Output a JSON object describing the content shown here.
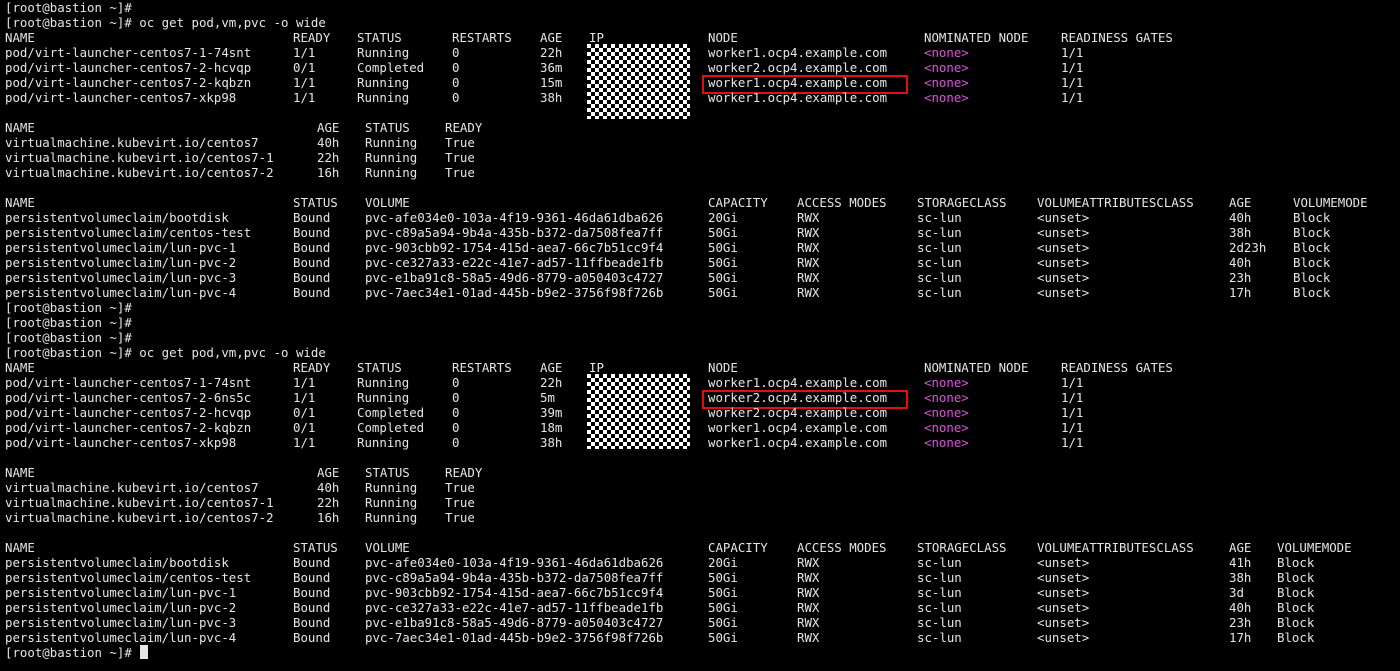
{
  "terminal": {
    "prompt": "[root@bastion ~]#",
    "command": " oc get pod,vm,pvc -o wide"
  },
  "blocks": [
    {
      "pod_header": [
        "NAME",
        "READY",
        "STATUS",
        "RESTARTS",
        "AGE",
        "IP",
        "NODE",
        "NOMINATED NODE",
        "READINESS GATES"
      ],
      "pods": [
        [
          "pod/virt-launcher-centos7-1-74snt",
          "1/1",
          "Running",
          "0",
          "22h",
          "",
          "worker1.ocp4.example.com",
          "<none>",
          "1/1"
        ],
        [
          "pod/virt-launcher-centos7-2-hcvqp",
          "0/1",
          "Completed",
          "0",
          "36m",
          "",
          "worker2.ocp4.example.com",
          "<none>",
          "1/1"
        ],
        [
          "pod/virt-launcher-centos7-2-kqbzn",
          "1/1",
          "Running",
          "0",
          "15m",
          "",
          "worker1.ocp4.example.com",
          "<none>",
          "1/1"
        ],
        [
          "pod/virt-launcher-centos7-xkp98",
          "1/1",
          "Running",
          "0",
          "38h",
          "",
          "worker1.ocp4.example.com",
          "<none>",
          "1/1"
        ]
      ],
      "vm_header": [
        "NAME",
        "AGE",
        "STATUS",
        "READY"
      ],
      "vms": [
        [
          "virtualmachine.kubevirt.io/centos7",
          "40h",
          "Running",
          "True"
        ],
        [
          "virtualmachine.kubevirt.io/centos7-1",
          "22h",
          "Running",
          "True"
        ],
        [
          "virtualmachine.kubevirt.io/centos7-2",
          "16h",
          "Running",
          "True"
        ]
      ],
      "pvc_header": [
        "NAME",
        "STATUS",
        "VOLUME",
        "CAPACITY",
        "ACCESS MODES",
        "STORAGECLASS",
        "VOLUMEATTRIBUTESCLASS",
        "AGE",
        "VOLUMEMODE"
      ],
      "pvcs": [
        [
          "persistentvolumeclaim/bootdisk",
          "Bound",
          "pvc-afe034e0-103a-4f19-9361-46da61dba626",
          "20Gi",
          "RWX",
          "sc-lun",
          "<unset>",
          "40h",
          "Block"
        ],
        [
          "persistentvolumeclaim/centos-test",
          "Bound",
          "pvc-c89a5a94-9b4a-435b-b372-da7508fea7ff",
          "50Gi",
          "RWX",
          "sc-lun",
          "<unset>",
          "38h",
          "Block"
        ],
        [
          "persistentvolumeclaim/lun-pvc-1",
          "Bound",
          "pvc-903cbb92-1754-415d-aea7-66c7b51cc9f4",
          "50Gi",
          "RWX",
          "sc-lun",
          "<unset>",
          "2d23h",
          "Block"
        ],
        [
          "persistentvolumeclaim/lun-pvc-2",
          "Bound",
          "pvc-ce327a33-e22c-41e7-ad57-11ffbeade1fb",
          "50Gi",
          "RWX",
          "sc-lun",
          "<unset>",
          "40h",
          "Block"
        ],
        [
          "persistentvolumeclaim/lun-pvc-3",
          "Bound",
          "pvc-e1ba91c8-58a5-49d6-8779-a050403c4727",
          "50Gi",
          "RWX",
          "sc-lun",
          "<unset>",
          "23h",
          "Block"
        ],
        [
          "persistentvolumeclaim/lun-pvc-4",
          "Bound",
          "pvc-7aec34e1-01ad-445b-b9e2-3756f98f726b",
          "50Gi",
          "RWX",
          "sc-lun",
          "<unset>",
          "17h",
          "Block"
        ]
      ]
    },
    {
      "pod_header": [
        "NAME",
        "READY",
        "STATUS",
        "RESTARTS",
        "AGE",
        "IP",
        "NODE",
        "NOMINATED NODE",
        "READINESS GATES"
      ],
      "pods": [
        [
          "pod/virt-launcher-centos7-1-74snt",
          "1/1",
          "Running",
          "0",
          "22h",
          "",
          "worker1.ocp4.example.com",
          "<none>",
          "1/1"
        ],
        [
          "pod/virt-launcher-centos7-2-6ns5c",
          "1/1",
          "Running",
          "0",
          "5m",
          "",
          "worker2.ocp4.example.com",
          "<none>",
          "1/1"
        ],
        [
          "pod/virt-launcher-centos7-2-hcvqp",
          "0/1",
          "Completed",
          "0",
          "39m",
          "",
          "worker2.ocp4.example.com",
          "<none>",
          "1/1"
        ],
        [
          "pod/virt-launcher-centos7-2-kqbzn",
          "0/1",
          "Completed",
          "0",
          "18m",
          "",
          "worker1.ocp4.example.com",
          "<none>",
          "1/1"
        ],
        [
          "pod/virt-launcher-centos7-xkp98",
          "1/1",
          "Running",
          "0",
          "38h",
          "",
          "worker1.ocp4.example.com",
          "<none>",
          "1/1"
        ]
      ],
      "vm_header": [
        "NAME",
        "AGE",
        "STATUS",
        "READY"
      ],
      "vms": [
        [
          "virtualmachine.kubevirt.io/centos7",
          "40h",
          "Running",
          "True"
        ],
        [
          "virtualmachine.kubevirt.io/centos7-1",
          "22h",
          "Running",
          "True"
        ],
        [
          "virtualmachine.kubevirt.io/centos7-2",
          "16h",
          "Running",
          "True"
        ]
      ],
      "pvc_header": [
        "NAME",
        "STATUS",
        "VOLUME",
        "CAPACITY",
        "ACCESS MODES",
        "STORAGECLASS",
        "VOLUMEATTRIBUTESCLASS",
        "AGE",
        "VOLUMEMODE"
      ],
      "pvcs": [
        [
          "persistentvolumeclaim/bootdisk",
          "Bound",
          "pvc-afe034e0-103a-4f19-9361-46da61dba626",
          "20Gi",
          "RWX",
          "sc-lun",
          "<unset>",
          "41h",
          "Block"
        ],
        [
          "persistentvolumeclaim/centos-test",
          "Bound",
          "pvc-c89a5a94-9b4a-435b-b372-da7508fea7ff",
          "50Gi",
          "RWX",
          "sc-lun",
          "<unset>",
          "38h",
          "Block"
        ],
        [
          "persistentvolumeclaim/lun-pvc-1",
          "Bound",
          "pvc-903cbb92-1754-415d-aea7-66c7b51cc9f4",
          "50Gi",
          "RWX",
          "sc-lun",
          "<unset>",
          "3d",
          "Block"
        ],
        [
          "persistentvolumeclaim/lun-pvc-2",
          "Bound",
          "pvc-ce327a33-e22c-41e7-ad57-11ffbeade1fb",
          "50Gi",
          "RWX",
          "sc-lun",
          "<unset>",
          "40h",
          "Block"
        ],
        [
          "persistentvolumeclaim/lun-pvc-3",
          "Bound",
          "pvc-e1ba91c8-58a5-49d6-8779-a050403c4727",
          "50Gi",
          "RWX",
          "sc-lun",
          "<unset>",
          "23h",
          "Block"
        ],
        [
          "persistentvolumeclaim/lun-pvc-4",
          "Bound",
          "pvc-7aec34e1-01ad-445b-b9e2-3756f98f726b",
          "50Gi",
          "RWX",
          "sc-lun",
          "<unset>",
          "17h",
          "Block"
        ]
      ]
    }
  ]
}
